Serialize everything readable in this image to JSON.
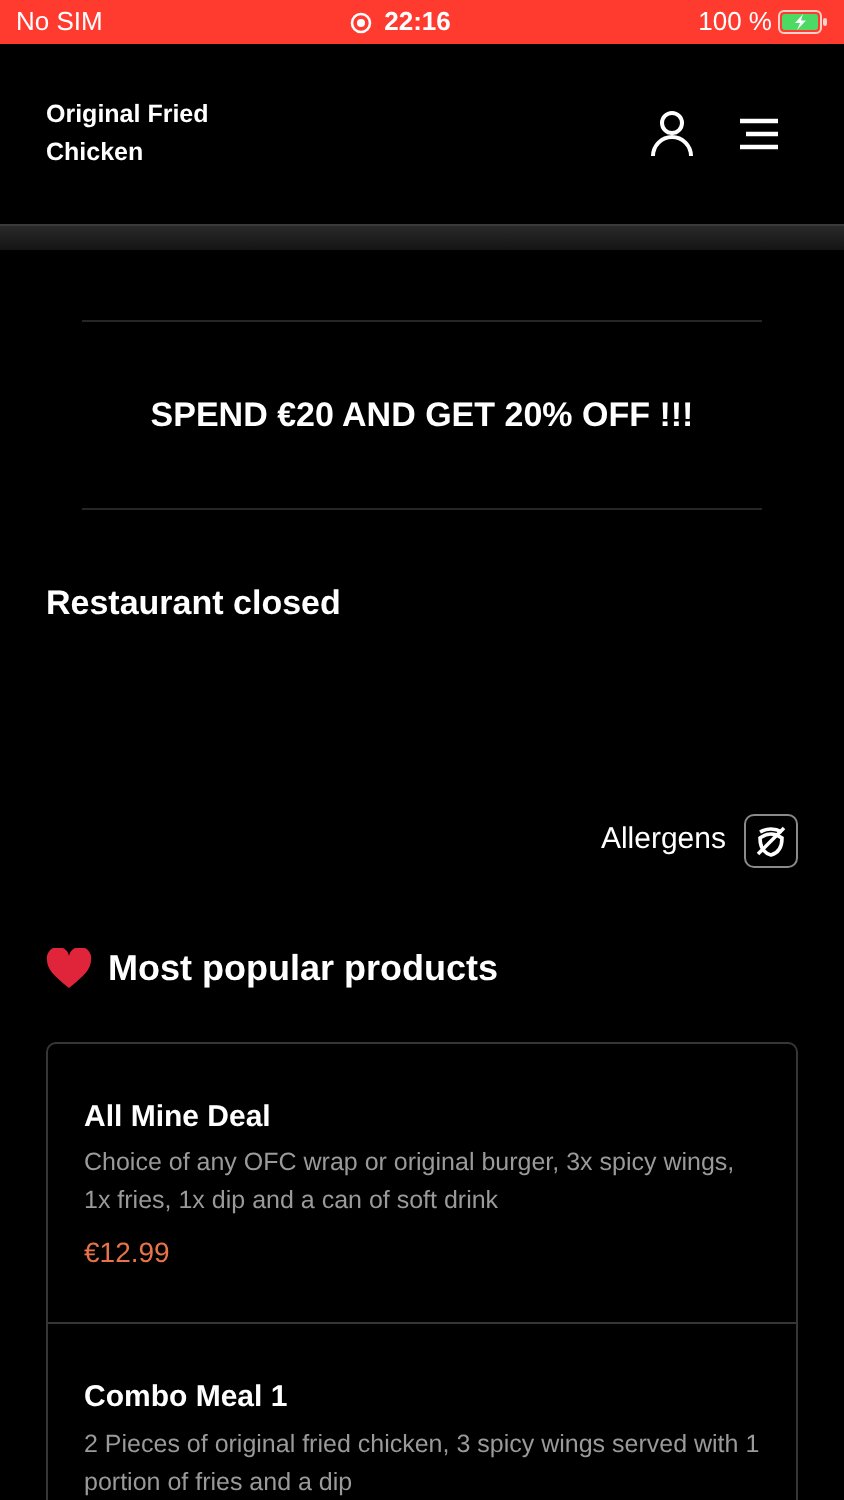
{
  "status_bar": {
    "carrier": "No SIM",
    "time": "22:16",
    "battery": "100 %"
  },
  "header": {
    "title": "Original Fried Chicken"
  },
  "promo": "SPEND €20 AND GET 20% OFF !!!",
  "restaurant_status": "Restaurant closed",
  "allergens_label": "Allergens",
  "section_title": "Most popular products",
  "products": [
    {
      "name": "All Mine Deal",
      "description": "Choice of any OFC wrap or original burger, 3x spicy wings, 1x fries, 1x dip and a can of soft drink",
      "price": "€12.99"
    },
    {
      "name": "Combo Meal 1",
      "description": "2 Pieces of original fried chicken, 3 spicy wings served with 1 portion of fries and a dip"
    }
  ]
}
